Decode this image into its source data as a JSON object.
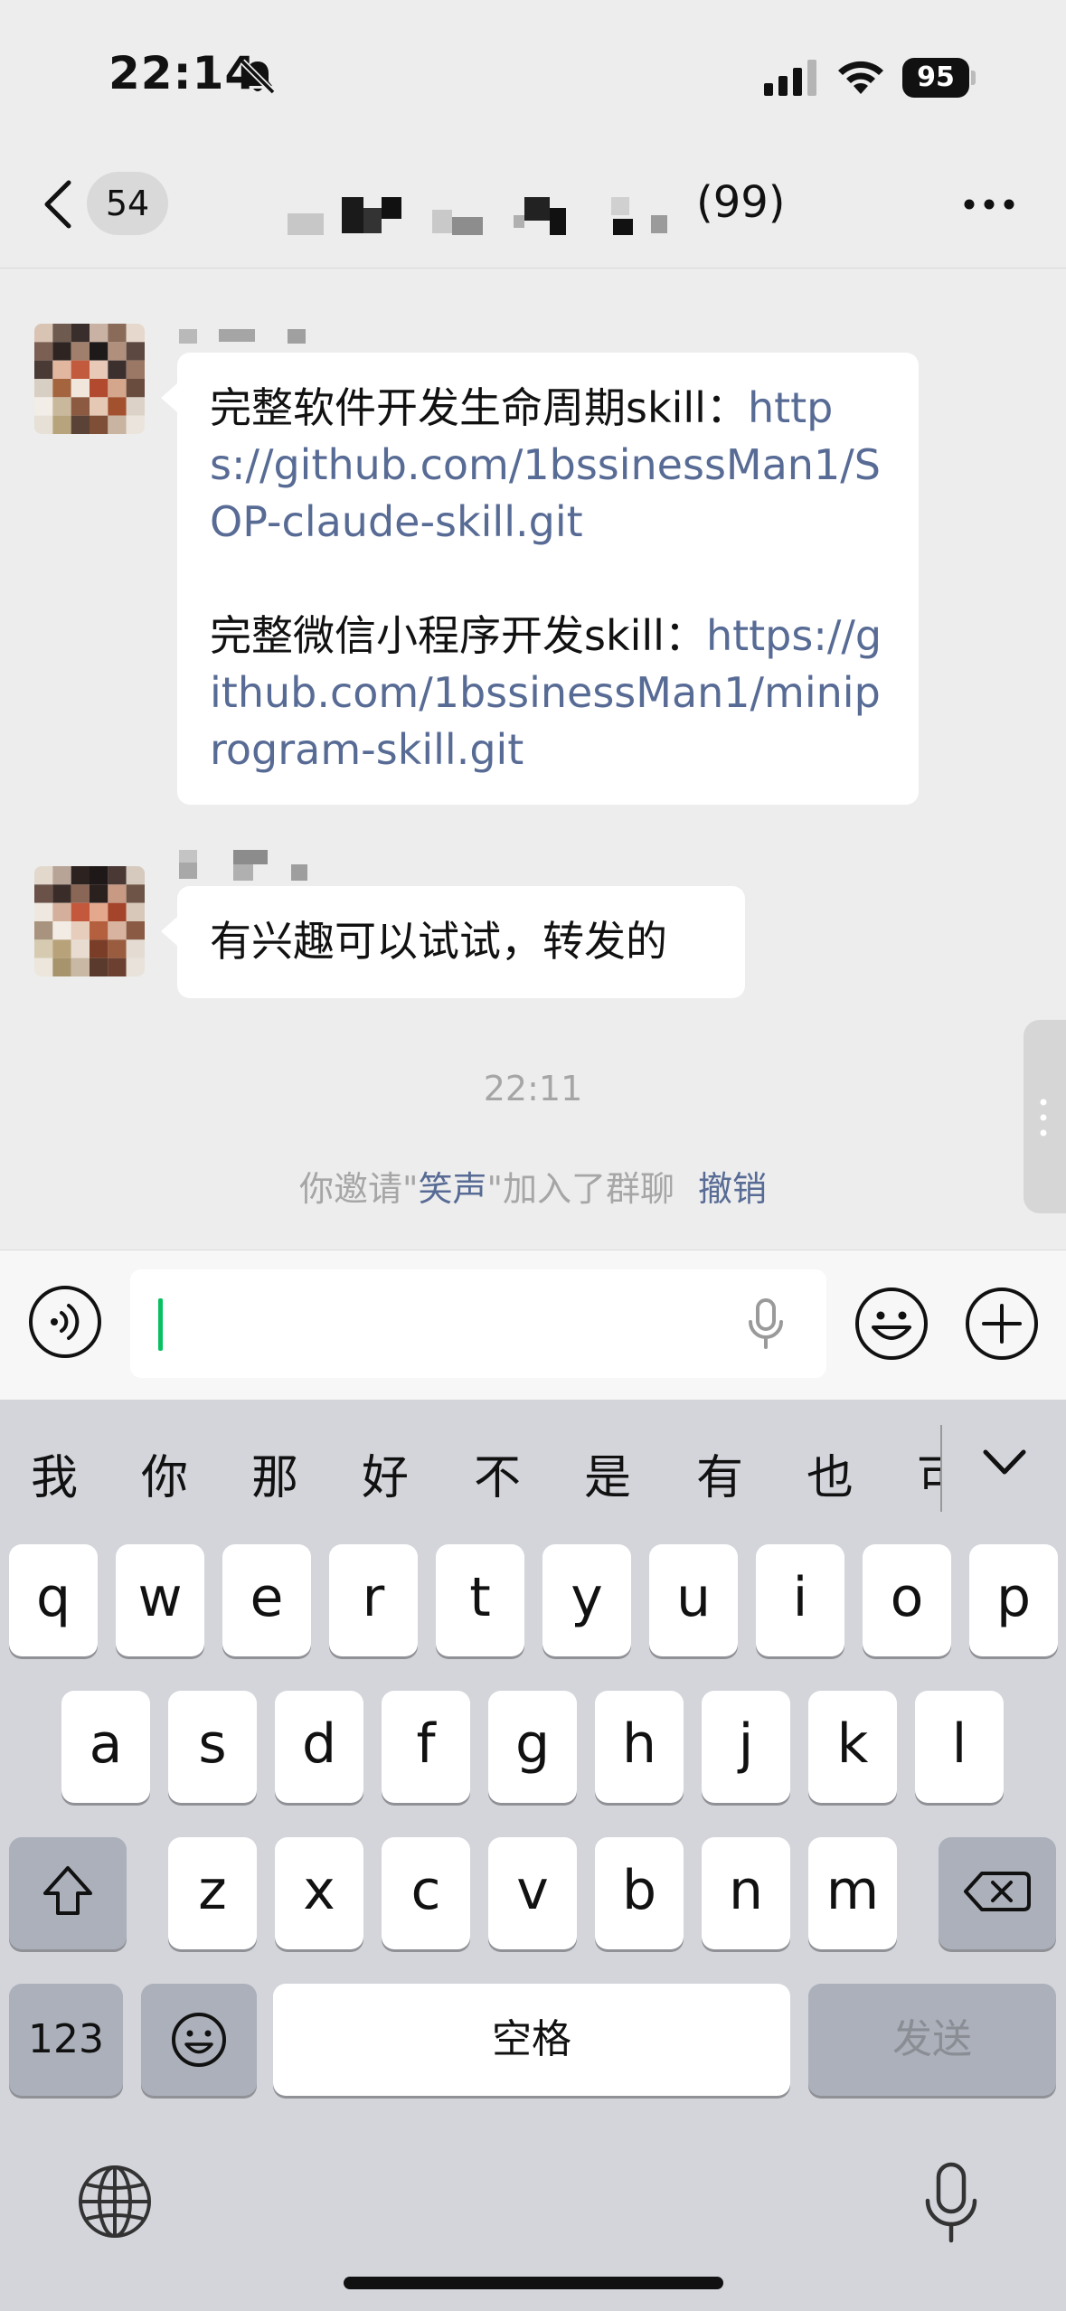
{
  "status_bar": {
    "time": "22:14",
    "battery": "95"
  },
  "nav": {
    "unread_count": "54",
    "title_suffix": "(99)"
  },
  "messages": [
    {
      "paragraphs": [
        {
          "text": "完整软件开发生命周期skill：",
          "link": "https://github.com/1bssinessMan1/SOP-claude-skill.git"
        },
        {
          "text": "完整微信小程序开发skill：",
          "link": "https://github.com/1bssinessMan1/miniprogram-skill.git"
        }
      ]
    },
    {
      "text": "有兴趣可以试试，转发的"
    }
  ],
  "system": {
    "time": "22:11",
    "invite_prefix": "你邀请\"",
    "invite_name": "笑声",
    "invite_suffix": "\"加入了群聊",
    "revoke_label": "撤销"
  },
  "keyboard": {
    "candidates": [
      "我",
      "你",
      "那",
      "好",
      "不",
      "是",
      "有",
      "也",
      "可"
    ],
    "row1": [
      "q",
      "w",
      "e",
      "r",
      "t",
      "y",
      "u",
      "i",
      "o",
      "p"
    ],
    "row2": [
      "a",
      "s",
      "d",
      "f",
      "g",
      "h",
      "j",
      "k",
      "l"
    ],
    "row3": [
      "z",
      "x",
      "c",
      "v",
      "b",
      "n",
      "m"
    ],
    "numbers_label": "123",
    "space_label": "空格",
    "send_label": "发送"
  },
  "colors": {
    "link": "#576b95",
    "cursor": "#07c160",
    "background": "#ededed"
  }
}
